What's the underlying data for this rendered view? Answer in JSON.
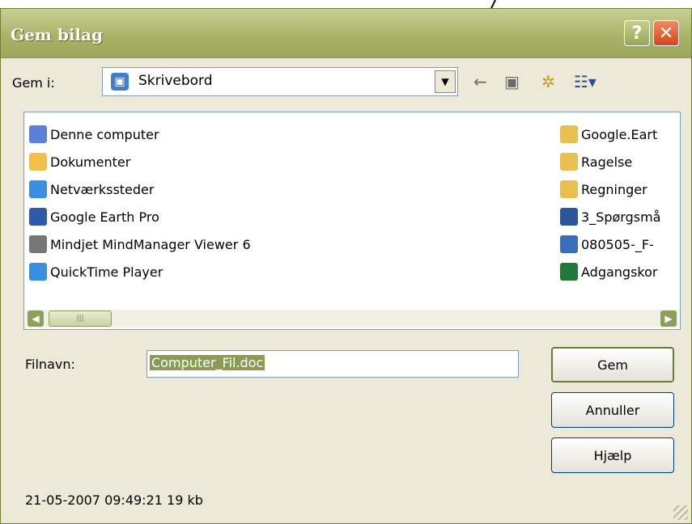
{
  "window": {
    "title": "Gem bilag"
  },
  "titlebar": {
    "help_label": "?",
    "close_label": "✕"
  },
  "save_in": {
    "label": "Gem i:",
    "value": "Skrivebord"
  },
  "toolbar": {
    "back": "←",
    "up": "▣",
    "new_folder": "✲",
    "view": "☷▾"
  },
  "left_items": [
    {
      "label": "Denne computer",
      "icon": "computer-icon",
      "color": "#5a7fd6"
    },
    {
      "label": "Dokumenter",
      "icon": "documents-folder-icon",
      "color": "#f0c04a"
    },
    {
      "label": "Netværkssteder",
      "icon": "network-icon",
      "color": "#3b8fe0"
    },
    {
      "label": "Google Earth Pro",
      "icon": "google-earth-icon",
      "color": "#2e5aa8"
    },
    {
      "label": "Mindjet MindManager Viewer 6",
      "icon": "mindmanager-icon",
      "color": "#777777"
    },
    {
      "label": "QuickTime Player",
      "icon": "quicktime-icon",
      "color": "#3a8ee0"
    }
  ],
  "right_items": [
    {
      "label": "Google.Eart",
      "icon": "folder-icon",
      "color": "#e8c050"
    },
    {
      "label": "Ragelse",
      "icon": "folder-icon",
      "color": "#e8c050"
    },
    {
      "label": "Regninger",
      "icon": "folder-icon",
      "color": "#e8c050"
    },
    {
      "label": "3_Spørgsmå",
      "icon": "word-doc-icon",
      "color": "#2b579a"
    },
    {
      "label": "080505-_F-",
      "icon": "media-file-icon",
      "color": "#3a6fb8"
    },
    {
      "label": "Adgangskor",
      "icon": "excel-file-icon",
      "color": "#1f7a3a"
    }
  ],
  "filename": {
    "label": "Filnavn:",
    "value": "Computer_Fil.doc"
  },
  "buttons": {
    "save": "Gem",
    "cancel": "Annuller",
    "help": "Hjælp"
  },
  "status": {
    "text": "21-05-2007 09:49:21 19 kb"
  }
}
